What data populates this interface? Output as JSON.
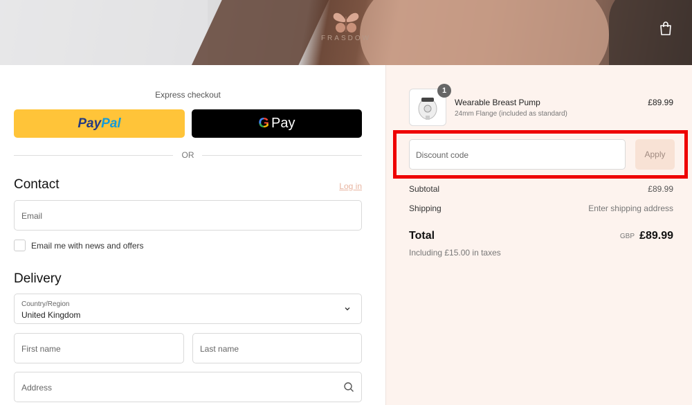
{
  "colors": {
    "paypal_yellow": "#ffc439",
    "gpay_black": "#000000",
    "login_link": "#e8b4a0",
    "summary_bg": "#fdf3ee",
    "apply_bg": "#f8e2d5",
    "highlight_red": "#ee0000"
  },
  "header": {
    "logo_text": "FRASDOW",
    "logo_icon": "butterfly-logo-icon",
    "cart_icon": "shopping-bag-icon"
  },
  "checkout": {
    "express_label": "Express checkout",
    "paypal_part1": "Pay",
    "paypal_part2": "Pal",
    "gpay_g": "G",
    "gpay_label": "Pay",
    "or_label": "OR",
    "contact": {
      "heading": "Contact",
      "login_link": "Log in",
      "email_placeholder": "Email",
      "newsletter_label": "Email me with news and offers"
    },
    "delivery": {
      "heading": "Delivery",
      "country_label": "Country/Region",
      "country_value": "United Kingdom",
      "first_name_placeholder": "First name",
      "last_name_placeholder": "Last name",
      "address_placeholder": "Address"
    }
  },
  "summary": {
    "item": {
      "name": "Wearable Breast Pump",
      "variant": "24mm Flange (included as standard)",
      "price": "£89.99",
      "quantity": "1"
    },
    "discount_placeholder": "Discount code",
    "apply_label": "Apply",
    "subtotal_label": "Subtotal",
    "subtotal_value": "£89.99",
    "shipping_label": "Shipping",
    "shipping_value": "Enter shipping address",
    "total_label": "Total",
    "currency": "GBP",
    "total_value": "£89.99",
    "tax_note": "Including £15.00 in taxes"
  }
}
